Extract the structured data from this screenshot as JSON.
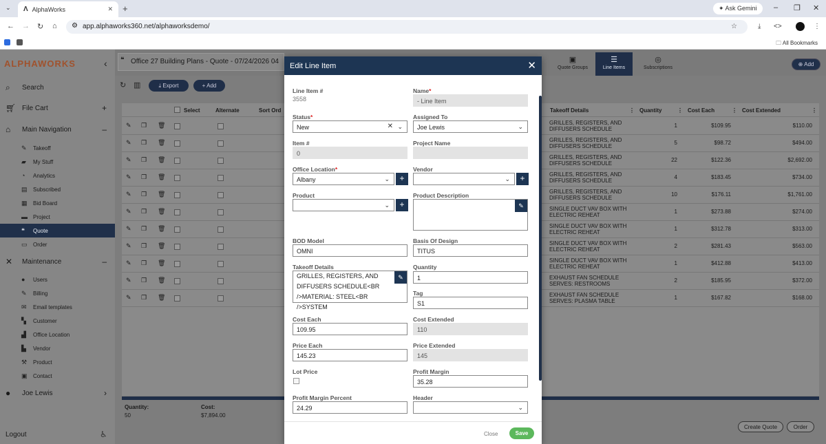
{
  "browser": {
    "tab_title": "AlphaWorks",
    "url": "app.alphaworks360.net/alphaworksdemo/",
    "ask_gemini": "Ask Gemini",
    "all_bookmarks": "All Bookmarks"
  },
  "brand": {
    "alpha": "ALPHA",
    "works": "WORKS"
  },
  "sidebar": {
    "search": "Search",
    "file_cart": "File Cart",
    "main_nav": "Main Navigation",
    "main_items": [
      {
        "label": "Takeoff",
        "icon": "takeoff-icon"
      },
      {
        "label": "My Stuff",
        "icon": "folder-user-icon"
      },
      {
        "label": "Analytics",
        "icon": "analytics-icon"
      },
      {
        "label": "Subscribed",
        "icon": "subscribed-icon"
      },
      {
        "label": "Bid Board",
        "icon": "bid-board-icon"
      },
      {
        "label": "Project",
        "icon": "folder-icon"
      },
      {
        "label": "Quote",
        "icon": "quote-icon"
      },
      {
        "label": "Order",
        "icon": "order-icon"
      }
    ],
    "maintenance": "Maintenance",
    "maint_items": [
      {
        "label": "Users",
        "icon": "user-icon"
      },
      {
        "label": "Billing",
        "icon": "billing-icon"
      },
      {
        "label": "Email templates",
        "icon": "email-icon"
      },
      {
        "label": "Customer",
        "icon": "customer-icon"
      },
      {
        "label": "Office Location",
        "icon": "building-icon"
      },
      {
        "label": "Vendor",
        "icon": "truck-icon"
      },
      {
        "label": "Product",
        "icon": "hammer-icon"
      },
      {
        "label": "Contact",
        "icon": "contact-icon"
      }
    ],
    "user": "Joe Lewis",
    "logout": "Logout"
  },
  "main": {
    "quote_title": "Office 27 Building Plans - Quote - 07/24/2026 04",
    "tabs": [
      "Quote Groups",
      "Line Items",
      "Subscriptions"
    ],
    "add": "Add",
    "export": "Export",
    "add_line": "Add"
  },
  "grid": {
    "columns": {
      "select": "Select",
      "alternate": "Alternate",
      "sort_order": "Sort Ord",
      "takeoff": "Takeoff Details",
      "quantity": "Quantity",
      "cost_each": "Cost Each",
      "cost_extended": "Cost Extended"
    },
    "rows": [
      {
        "desc": "GRILLES, REGISTERS, AND DIFFUSERS SCHEDULE",
        "qty": "1",
        "cost": "$109.95",
        "ext": "$110.00"
      },
      {
        "desc": "GRILLES, REGISTERS, AND DIFFUSERS SCHEDULE",
        "qty": "5",
        "cost": "$98.72",
        "ext": "$494.00"
      },
      {
        "desc": "GRILLES, REGISTERS, AND DIFFUSERS SCHEDULE",
        "qty": "22",
        "cost": "$122.36",
        "ext": "$2,692.00"
      },
      {
        "desc": "GRILLES, REGISTERS, AND DIFFUSERS SCHEDULE",
        "qty": "4",
        "cost": "$183.45",
        "ext": "$734.00"
      },
      {
        "desc": "GRILLES, REGISTERS, AND DIFFUSERS SCHEDULE",
        "qty": "10",
        "cost": "$176.11",
        "ext": "$1,761.00"
      },
      {
        "desc": "SINGLE DUCT VAV BOX WITH ELECTRIC REHEAT",
        "qty": "1",
        "cost": "$273.88",
        "ext": "$274.00"
      },
      {
        "desc": "SINGLE DUCT VAV BOX WITH ELECTRIC REHEAT",
        "qty": "1",
        "cost": "$312.78",
        "ext": "$313.00"
      },
      {
        "desc": "SINGLE DUCT VAV BOX WITH ELECTRIC REHEAT",
        "qty": "2",
        "cost": "$281.43",
        "ext": "$563.00"
      },
      {
        "desc": "SINGLE DUCT VAV BOX WITH ELECTRIC REHEAT",
        "qty": "1",
        "cost": "$412.88",
        "ext": "$413.00"
      },
      {
        "desc": "EXHAUST FAN SCHEDULE SERVES: RESTROOMS",
        "qty": "2",
        "cost": "$185.95",
        "ext": "$372.00"
      },
      {
        "desc": "EXHAUST FAN SCHEDULE SERVES: PLASMA TABLE",
        "qty": "1",
        "cost": "$167.82",
        "ext": "$168.00"
      }
    ],
    "footer": {
      "qty_label": "Quantity:",
      "qty_value": "50",
      "cost_label": "Cost:",
      "cost_value": "$7,894.00"
    },
    "create_quote": "Create Quote",
    "order": "Order"
  },
  "modal": {
    "title": "Edit Line Item",
    "fields": {
      "line_item_label": "Line Item #",
      "line_item_value": "3558",
      "name_label": "Name",
      "name_value": "- Line Item",
      "status_label": "Status",
      "status_value": "New",
      "assigned_label": "Assigned To",
      "assigned_value": "Joe Lewis",
      "item_no_label": "Item #",
      "item_no_value": "0",
      "project_label": "Project Name",
      "project_value": "",
      "office_label": "Office Location",
      "office_value": "Albany",
      "vendor_label": "Vendor",
      "vendor_value": "",
      "product_label": "Product",
      "product_value": "",
      "product_desc_label": "Product Description",
      "product_desc_value": "",
      "bod_label": "BOD Model",
      "bod_value": "OMNI",
      "basis_label": "Basis Of Design",
      "basis_value": "TITUS",
      "takeoff_label": "Takeoff Details",
      "takeoff_value": "GRILLES, REGISTERS, AND DIFFUSERS SCHEDULE<BR />MATERIAL: STEEL<BR />SYSTEM",
      "quantity_label": "Quantity",
      "quantity_value": "1",
      "tag_label": "Tag",
      "tag_value": "S1",
      "cost_each_label": "Cost Each",
      "cost_each_value": "109.95",
      "cost_ext_label": "Cost Extended",
      "cost_ext_value": "110",
      "price_each_label": "Price Each",
      "price_each_value": "145.23",
      "price_ext_label": "Price Extended",
      "price_ext_value": "145",
      "lot_price_label": "Lot Price",
      "profit_margin_label": "Profit Margin",
      "profit_margin_value": "35.28",
      "pm_percent_label": "Profit Margin Percent",
      "pm_percent_value": "24.29",
      "header_label": "Header",
      "header_value": ""
    },
    "close": "Close",
    "save": "Save"
  }
}
